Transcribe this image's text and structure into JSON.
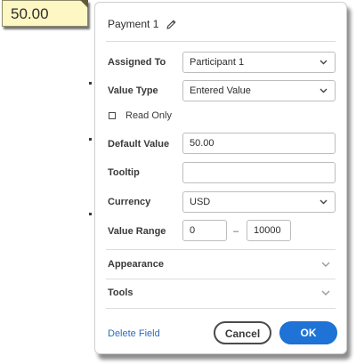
{
  "field": {
    "value": "50.00"
  },
  "panel": {
    "title": "Payment 1",
    "title_icon": "pencil-icon",
    "assigned_to": {
      "label": "Assigned To",
      "value": "Participant 1"
    },
    "value_type": {
      "label": "Value Type",
      "value": "Entered Value"
    },
    "read_only": {
      "label": "Read Only",
      "checked": false
    },
    "default_value": {
      "label": "Default Value",
      "value": "50.00"
    },
    "tooltip": {
      "label": "Tooltip",
      "value": ""
    },
    "currency": {
      "label": "Currency",
      "value": "USD"
    },
    "value_range": {
      "label": "Value Range",
      "min": "0",
      "separator": "–",
      "max": "10000"
    },
    "sections": [
      {
        "label": "Appearance"
      },
      {
        "label": "Tools"
      }
    ],
    "footer": {
      "delete_label": "Delete Field",
      "cancel_label": "Cancel",
      "ok_label": "OK"
    }
  },
  "colors": {
    "field_background": "#fdf7c4",
    "link": "#2b6cbf",
    "primary_button": "#1f73d6"
  }
}
